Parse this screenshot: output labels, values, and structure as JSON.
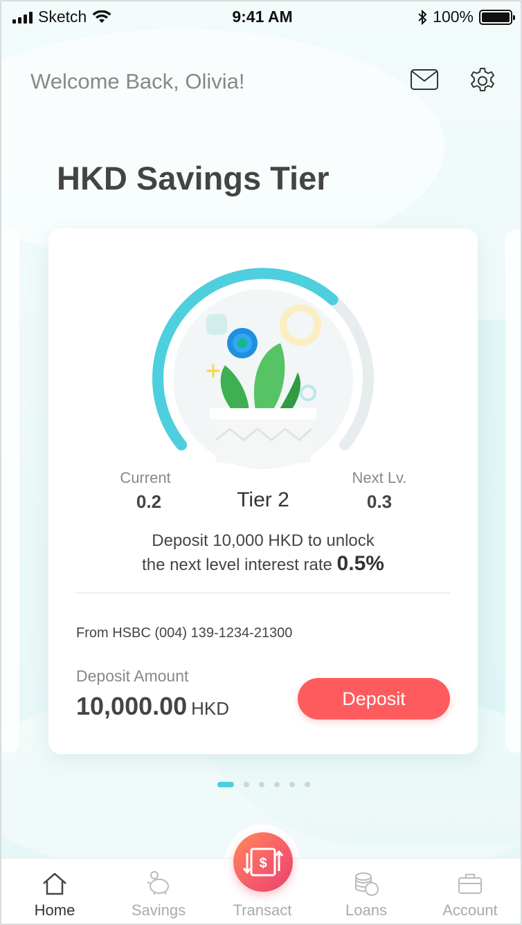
{
  "status_bar": {
    "carrier": "Sketch",
    "time": "9:41 AM",
    "battery": "100%"
  },
  "header": {
    "welcome": "Welcome Back, Olivia!",
    "mail_icon": "mail-icon",
    "settings_icon": "gear-icon"
  },
  "page_title": "HKD Savings Tier",
  "tier_card": {
    "progress_fraction": 0.66,
    "current_label": "Current",
    "current_value": "0.2",
    "tier_name": "Tier 2",
    "next_label": "Next Lv.",
    "next_value": "0.3",
    "message_line1": "Deposit 10,000 HKD to unlock",
    "message_line2": "the next level interest rate",
    "message_rate": "0.5%",
    "from_account": "From HSBC (004) 139-1234-21300",
    "deposit_label": "Deposit Amount",
    "deposit_amount": "10,000.00",
    "deposit_currency": "HKD",
    "deposit_button": "Deposit"
  },
  "pager": {
    "total": 6,
    "active_index": 0
  },
  "tabbar": {
    "items": [
      {
        "label": "Home",
        "icon": "home-icon",
        "active": true
      },
      {
        "label": "Savings",
        "icon": "piggy-bank-icon",
        "active": false
      },
      {
        "label": "Transact",
        "icon": "transfer-dollar-icon",
        "active": false
      },
      {
        "label": "Loans",
        "icon": "coins-icon",
        "active": false
      },
      {
        "label": "Account",
        "icon": "briefcase-icon",
        "active": false
      }
    ]
  },
  "colors": {
    "accent": "#4dcfdd",
    "deposit_button": "#fe5b5e",
    "transact_gradient_start": "#ff8a5c",
    "transact_gradient_end": "#e8436c"
  }
}
